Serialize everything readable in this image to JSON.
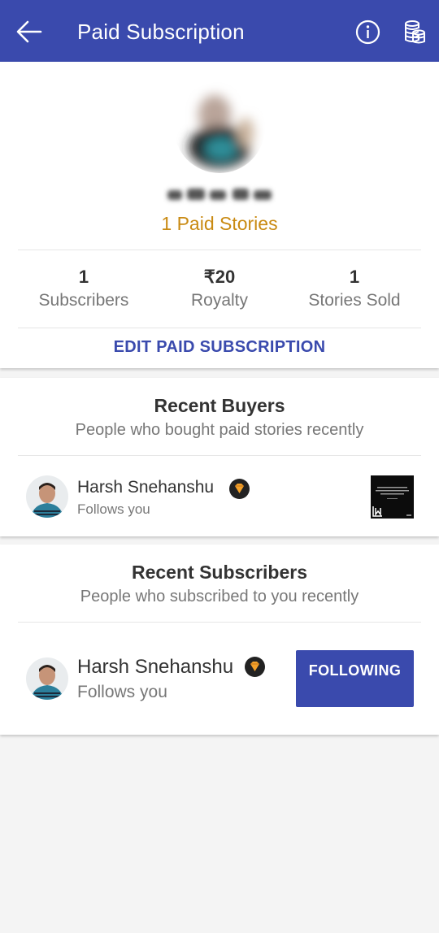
{
  "appbar": {
    "title": "Paid Subscription",
    "back_icon": "arrow-left-icon",
    "info_icon": "info-icon",
    "coins_icon": "coins-icon",
    "color": "#3a4aad"
  },
  "profile": {
    "paid_stories": "1 Paid Stories"
  },
  "stats": [
    {
      "value": "1",
      "label": "Subscribers"
    },
    {
      "value": "₹20",
      "label": "Royalty"
    },
    {
      "value": "1",
      "label": "Stories Sold"
    }
  ],
  "edit_button": "EDIT PAID SUBSCRIPTION",
  "recent_buyers": {
    "title": "Recent Buyers",
    "subtitle": "People who bought paid stories recently",
    "user": {
      "name": "Harsh Snehanshu",
      "status": "Follows you",
      "badge_icon": "diamond-icon"
    }
  },
  "recent_subscribers": {
    "title": "Recent Subscribers",
    "subtitle": "People who subscribed to you recently",
    "user": {
      "name": "Harsh Snehanshu",
      "status": "Follows you",
      "badge_icon": "diamond-icon"
    },
    "button": "FOLLOWING"
  }
}
